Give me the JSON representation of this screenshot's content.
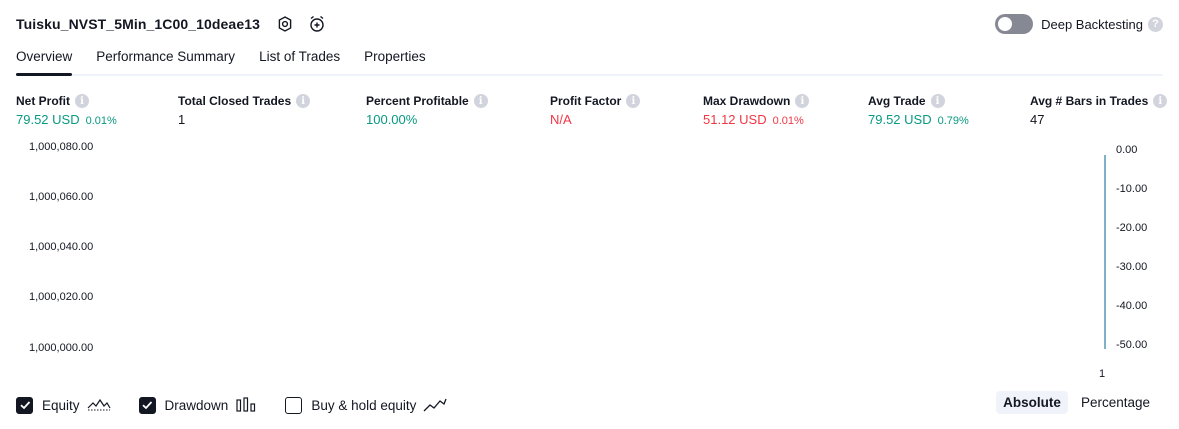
{
  "header": {
    "strategy_name": "Tuisku_NVST_5Min_1C00_10deae13",
    "deep_backtesting_label": "Deep Backtesting",
    "help_glyph": "?"
  },
  "tabs": [
    {
      "label": "Overview",
      "active": true
    },
    {
      "label": "Performance Summary",
      "active": false
    },
    {
      "label": "List of Trades",
      "active": false
    },
    {
      "label": "Properties",
      "active": false
    }
  ],
  "metrics": [
    {
      "title": "Net Profit",
      "value": "79.52 USD",
      "sub": "0.01%",
      "color": "green"
    },
    {
      "title": "Total Closed Trades",
      "value": "1",
      "sub": "",
      "color": "dark"
    },
    {
      "title": "Percent Profitable",
      "value": "100.00%",
      "sub": "",
      "color": "green"
    },
    {
      "title": "Profit Factor",
      "value": "N/A",
      "sub": "",
      "color": "red"
    },
    {
      "title": "Max Drawdown",
      "value": "51.12 USD",
      "sub": "0.01%",
      "color": "red"
    },
    {
      "title": "Avg Trade",
      "value": "79.52 USD",
      "sub": "0.79%",
      "color": "green"
    },
    {
      "title": "Avg # Bars in Trades",
      "value": "47",
      "sub": "",
      "color": "dark"
    }
  ],
  "info_glyph": "i",
  "chart_data": {
    "type": "line",
    "left_axis_ticks": [
      "1,000,080.00",
      "1,000,060.00",
      "1,000,040.00",
      "1,000,020.00",
      "1,000,000.00"
    ],
    "right_axis_ticks": [
      "0.00",
      "-10.00",
      "-20.00",
      "-30.00",
      "-40.00",
      "-50.00"
    ],
    "x_ticks": [
      "1"
    ],
    "ylim_left": [
      1000000,
      1000080
    ],
    "ylim_right": [
      -50,
      0
    ],
    "series": [
      {
        "name": "Drawdown",
        "values": [
          -51.12
        ],
        "color": "#7fb2c8"
      }
    ]
  },
  "footer": {
    "legend": [
      {
        "label": "Equity",
        "checked": true,
        "icon": "equity-line-icon"
      },
      {
        "label": "Drawdown",
        "checked": true,
        "icon": "drawdown-bars-icon"
      },
      {
        "label": "Buy & hold equity",
        "checked": false,
        "icon": "buy-hold-line-icon"
      }
    ],
    "modes": [
      {
        "label": "Absolute",
        "active": true
      },
      {
        "label": "Percentage",
        "active": false
      }
    ]
  }
}
